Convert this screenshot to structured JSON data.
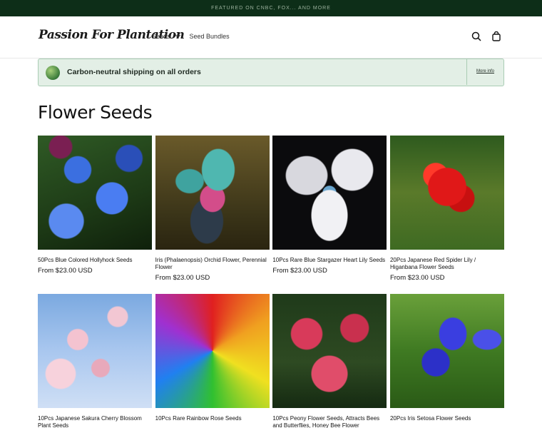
{
  "announcement": {
    "text": "FEATURED ON CNBC, FOX... AND MORE"
  },
  "header": {
    "logo": "Passion For Plantation",
    "nav": [
      {
        "label": "Seeds",
        "has_dropdown": true
      },
      {
        "label": "Seed Bundles",
        "has_dropdown": false
      }
    ],
    "icons": [
      "search-icon",
      "cart-icon"
    ]
  },
  "banner": {
    "text": "Carbon-neutral shipping on all orders",
    "link": "More info"
  },
  "collection": {
    "title": "Flower Seeds",
    "products": [
      {
        "title": "50Pcs Blue Colored Hollyhock Seeds",
        "price": "From $23.00 USD"
      },
      {
        "title": "Iris (Phalaenopsis) Orchid Flower, Perennial Flower",
        "price": "From $23.00 USD"
      },
      {
        "title": "10Pcs Rare Blue Stargazer Heart Lily Seeds",
        "price": "From $23.00 USD"
      },
      {
        "title": "20Pcs Japanese Red Spider Lily / Higanbana Flower Seeds",
        "price": "From $23.00 USD"
      },
      {
        "title": "10Pcs Japanese Sakura Cherry Blossom Plant Seeds",
        "price": ""
      },
      {
        "title": "10Pcs Rare Rainbow Rose Seeds",
        "price": ""
      },
      {
        "title": "10Pcs Peony Flower Seeds, Attracts Bees and Butterflies, Honey Bee Flower",
        "price": ""
      },
      {
        "title": "20Pcs Iris Setosa Flower Seeds",
        "price": ""
      }
    ]
  },
  "colors": {
    "announcement_bg": "#0d2e18",
    "banner_bg": "#e3efe6",
    "banner_border": "#a9cdb4"
  }
}
